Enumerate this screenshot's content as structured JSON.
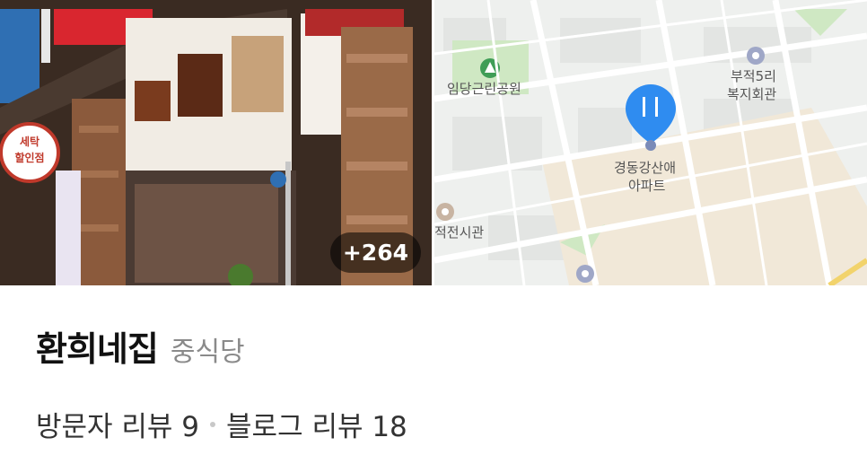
{
  "gallery": {
    "photo_count_badge": "+264",
    "map_labels": {
      "park": "임당근린공원",
      "welfare_center_line1": "부적5리",
      "welfare_center_line2": "복지회관",
      "apartment_line1": "경동강산애",
      "apartment_line2": "아파트",
      "hall": "적전시관"
    },
    "shop_sign": {
      "laundry_line1": "세탁",
      "laundry_line2": "할인점"
    }
  },
  "place": {
    "name": "환희네집",
    "category": "중식당"
  },
  "reviews": {
    "visitor_label": "방문자 리뷰 9",
    "blog_label": "블로그 리뷰 18"
  },
  "colors": {
    "map_pin": "#2f8cf0",
    "park_green": "#cfe8c3",
    "map_background": "#eef0ee"
  }
}
